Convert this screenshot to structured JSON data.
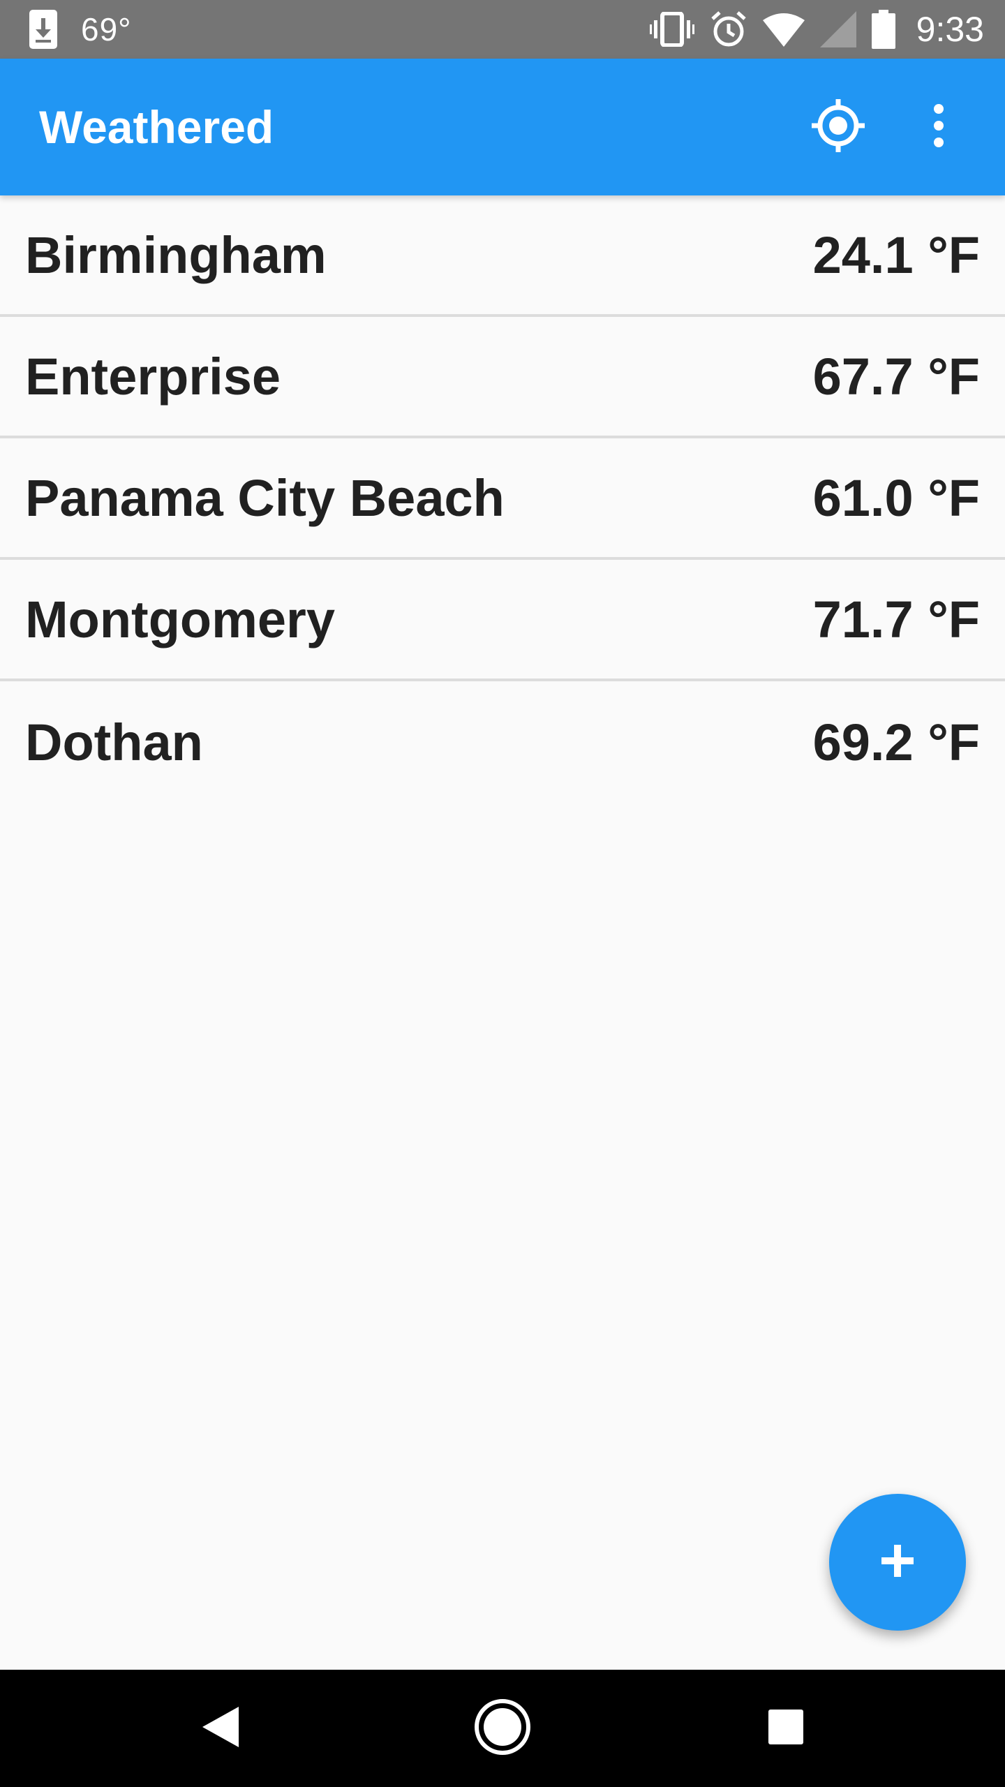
{
  "status_bar": {
    "temperature": "69°",
    "time": "9:33",
    "icons": [
      "download-icon",
      "vibrate-icon",
      "alarm-icon",
      "wifi-icon",
      "cell-signal-icon",
      "battery-icon"
    ]
  },
  "app_bar": {
    "title": "Weathered",
    "actions": [
      "my-location-icon",
      "more-vert-icon"
    ],
    "color": "#2196f3"
  },
  "cities": [
    {
      "name": "Birmingham",
      "temperature": "24.1 °F"
    },
    {
      "name": "Enterprise",
      "temperature": "67.7 °F"
    },
    {
      "name": "Panama City Beach",
      "temperature": "61.0 °F"
    },
    {
      "name": "Montgomery",
      "temperature": "71.7 °F"
    },
    {
      "name": "Dothan",
      "temperature": "69.2 °F"
    }
  ],
  "fab": {
    "icon": "plus-icon",
    "color": "#2196f3"
  },
  "nav_bar": {
    "buttons": [
      "back-icon",
      "home-icon",
      "recents-icon"
    ]
  }
}
